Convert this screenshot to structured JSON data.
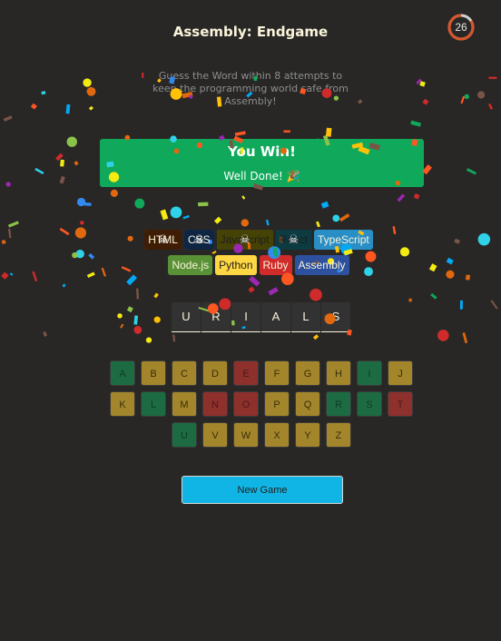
{
  "header": {
    "title": "Assembly: Endgame",
    "subtitle": "Guess the Word within 8 attempts to keep the programming world safe from Assembly!",
    "timer": "26"
  },
  "status": {
    "title": "You Win!",
    "message": "Well Done! 🎉"
  },
  "languages": [
    {
      "name": "HTML",
      "bg": "#e2680f",
      "fg": "#f9f4da",
      "lost": true
    },
    {
      "name": "CSS",
      "bg": "#328af1",
      "fg": "#f9f4da",
      "lost": true
    },
    {
      "name": "Javascript",
      "bg": "#f4eb13",
      "fg": "#1e1e1e",
      "lost": true
    },
    {
      "name": "React",
      "bg": "#2ed3e9",
      "fg": "#1e1e1e",
      "lost": true
    },
    {
      "name": "TypeScript",
      "bg": "#298ec6",
      "fg": "#f9f4da",
      "lost": false
    },
    {
      "name": "Node.js",
      "bg": "#599137",
      "fg": "#f9f4da",
      "lost": false
    },
    {
      "name": "Python",
      "bg": "#ffd742",
      "fg": "#1e1e1e",
      "lost": false
    },
    {
      "name": "Ruby",
      "bg": "#d02b2b",
      "fg": "#f9f4da",
      "lost": false
    },
    {
      "name": "Assembly",
      "bg": "#2d519f",
      "fg": "#f9f4da",
      "lost": false
    }
  ],
  "word": [
    "U",
    "R",
    "I",
    "A",
    "L",
    "S"
  ],
  "keyboard": [
    {
      "k": "A",
      "s": "right"
    },
    {
      "k": "B",
      "s": "none"
    },
    {
      "k": "C",
      "s": "none"
    },
    {
      "k": "D",
      "s": "none"
    },
    {
      "k": "E",
      "s": "wrong"
    },
    {
      "k": "F",
      "s": "none"
    },
    {
      "k": "G",
      "s": "none"
    },
    {
      "k": "H",
      "s": "none"
    },
    {
      "k": "I",
      "s": "right"
    },
    {
      "k": "J",
      "s": "none"
    },
    {
      "k": "K",
      "s": "none"
    },
    {
      "k": "L",
      "s": "right"
    },
    {
      "k": "M",
      "s": "none"
    },
    {
      "k": "N",
      "s": "wrong"
    },
    {
      "k": "O",
      "s": "wrong"
    },
    {
      "k": "P",
      "s": "none"
    },
    {
      "k": "Q",
      "s": "none"
    },
    {
      "k": "R",
      "s": "right"
    },
    {
      "k": "S",
      "s": "right"
    },
    {
      "k": "T",
      "s": "wrong"
    },
    {
      "k": "U",
      "s": "right"
    },
    {
      "k": "V",
      "s": "none"
    },
    {
      "k": "W",
      "s": "none"
    },
    {
      "k": "X",
      "s": "none"
    },
    {
      "k": "Y",
      "s": "none"
    },
    {
      "k": "Z",
      "s": "none"
    }
  ],
  "new_game_label": "New Game",
  "colors": {
    "background": "#282726",
    "win_banner": "#10a95b",
    "new_game_button": "#11b5e5"
  }
}
